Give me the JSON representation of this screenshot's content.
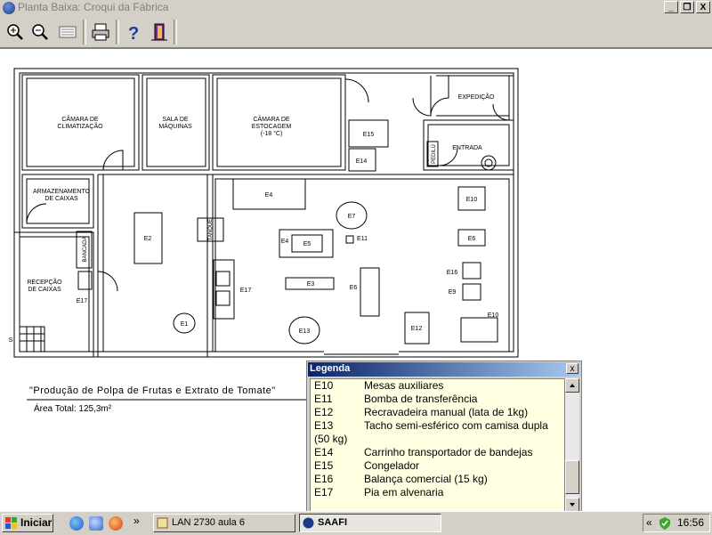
{
  "window": {
    "title": "Planta Baixa: Croqui da Fábrica",
    "buttons": {
      "minimize": "_",
      "maximize": "❐",
      "close": "X"
    }
  },
  "toolbar": {
    "icons": [
      "zoom-in-icon",
      "zoom-out-icon",
      "page-view-icon",
      "print-icon",
      "help-icon",
      "exit-door-icon"
    ]
  },
  "floorplan": {
    "rooms": {
      "camara_climatizacao": [
        "CÂMARA DE",
        "CLIMATIZAÇÃO"
      ],
      "sala_maquinas": [
        "SALA DE",
        "MÁQUINAS"
      ],
      "camara_estocagem": [
        "CÂMARA DE",
        "ESTOCAGEM",
        "(-18 °C)"
      ],
      "expedicao": "EXPEDIÇÃO",
      "entrada": "ENTRADA",
      "pedilu": "PEDILÚ",
      "armazenamento": [
        "ARMAZENAMENTO",
        "DE CAIXAS"
      ],
      "recepcao": [
        "RECEPÇÃO",
        "DE CAIXAS"
      ],
      "bancada": "BANCADA",
      "tanque": "TANQUE",
      "stair_label": "S"
    },
    "equipment": {
      "E1": "E1",
      "E2": "E2",
      "E3": "E3",
      "E4": "E4",
      "E4b": "E4",
      "E5": "E5",
      "E6": "E6",
      "E6b": "E6",
      "E7": "E7",
      "E9": "E9",
      "E10": "E10",
      "E10b": "E10",
      "E11": "E11",
      "E12": "E12",
      "E13": "E13",
      "E14": "E14",
      "E15": "E15",
      "E16": "E16",
      "E17": "E17",
      "E17b": "E17"
    },
    "caption": "\"Produção de Polpa de Frutas e Extrato de Tomate\"",
    "area": "Área Total: 125,3m²"
  },
  "legend": {
    "title": "Legenda",
    "close": "x",
    "items": [
      {
        "code": "E10",
        "desc": "Mesas auxiliares"
      },
      {
        "code": "E11",
        "desc": "Bomba de transferência"
      },
      {
        "code": "E12",
        "desc": "Recravadeira manual (lata de 1kg)"
      },
      {
        "code": "E13",
        "desc": "Tacho semi-esférico com camisa dupla"
      },
      {
        "code": "",
        "desc": "(50 kg)"
      },
      {
        "code": "E14",
        "desc": "Carrinho transportador de bandejas"
      },
      {
        "code": "E15",
        "desc": "Congelador"
      },
      {
        "code": "E16",
        "desc": "Balança comercial (15 kg)"
      },
      {
        "code": "E17",
        "desc": "Pia em alvenaria"
      }
    ]
  },
  "taskbar": {
    "start": "Iniciar",
    "chevron": "»",
    "tasks": [
      "LAN 2730 aula 6",
      "SAAFI"
    ],
    "tray_chevron": "«",
    "clock": "16:56"
  }
}
